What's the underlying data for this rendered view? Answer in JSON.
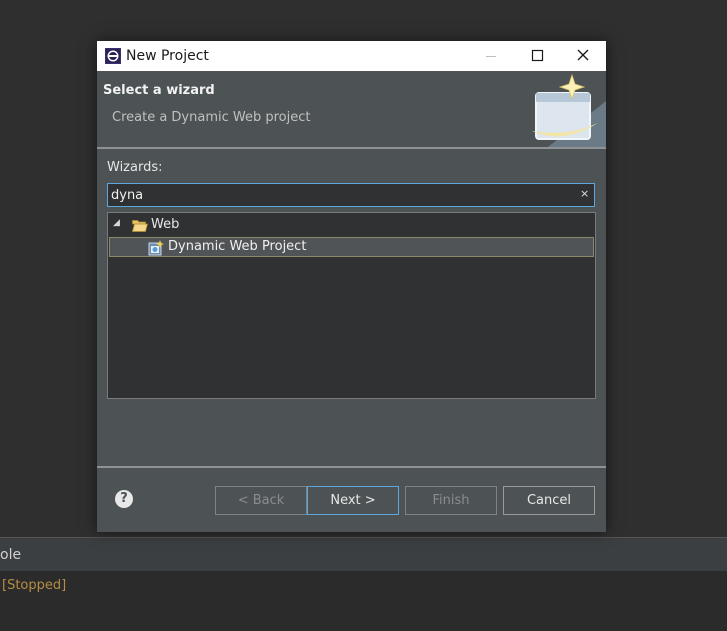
{
  "dialog": {
    "title": "New Project",
    "header_title": "Select a wizard",
    "header_description": "Create a Dynamic Web project",
    "wizards_label": "Wizards:",
    "filter_value": "dyna",
    "filter_clear_icon": "×",
    "tree": [
      {
        "label": "Web",
        "icon": "folder-open-icon",
        "expanded": true,
        "children": [
          {
            "label": "Dynamic Web Project",
            "icon": "web-project-icon",
            "selected": true
          }
        ]
      }
    ],
    "buttons": {
      "help": "?",
      "back": "< Back",
      "next": "Next >",
      "finish": "Finish",
      "cancel": "Cancel"
    }
  },
  "console": {
    "tab_label": "ole",
    "status": "[Stopped]"
  },
  "colors": {
    "dialog_background": "#4d5254",
    "focus_accent": "#5aa6dd",
    "status_text": "#b58d44"
  }
}
